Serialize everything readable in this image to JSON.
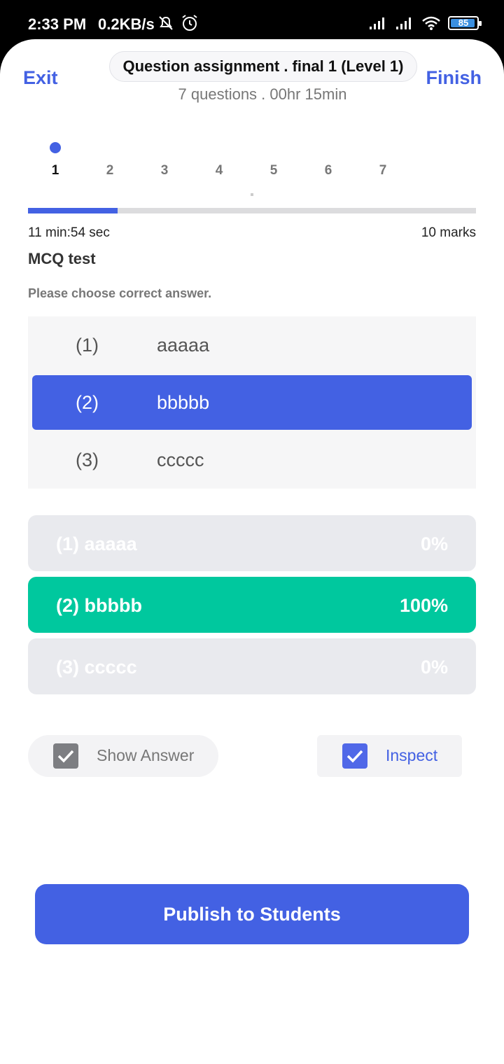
{
  "status_bar": {
    "time": "2:33 PM",
    "net_speed": "0.2KB/s",
    "battery": "85",
    "icons": [
      "bell-off-icon",
      "alarm-icon",
      "signal-icon",
      "signal-icon",
      "wifi-icon",
      "battery-icon"
    ]
  },
  "header": {
    "exit_label": "Exit",
    "finish_label": "Finish",
    "title": "Question assignment . final 1 (Level 1)",
    "subtitle": "7 questions . 00hr 15min"
  },
  "question_nav": {
    "numbers": [
      "1",
      "2",
      "3",
      "4",
      "5",
      "6",
      "7"
    ],
    "active": "1",
    "progress_fraction": 0.2
  },
  "question": {
    "timer": "11 min:54 sec",
    "marks": "10 marks",
    "type_title": "MCQ test",
    "instruction": "Please choose correct answer.",
    "options": [
      {
        "num": "(1)",
        "text": "aaaaa",
        "selected": false
      },
      {
        "num": "(2)",
        "text": "bbbbb",
        "selected": true
      },
      {
        "num": "(3)",
        "text": "ccccc",
        "selected": false
      }
    ]
  },
  "results": [
    {
      "label": "(1) aaaaa",
      "percent": "0%",
      "correct": false
    },
    {
      "label": "(2) bbbbb",
      "percent": "100%",
      "correct": true
    },
    {
      "label": "(3) ccccc",
      "percent": "0%",
      "correct": false
    }
  ],
  "toggles": {
    "show_answer_label": "Show Answer",
    "inspect_label": "Inspect"
  },
  "colors": {
    "accent": "#4361e3",
    "correct": "#00c89e"
  },
  "publish_label": "Publish to Students"
}
